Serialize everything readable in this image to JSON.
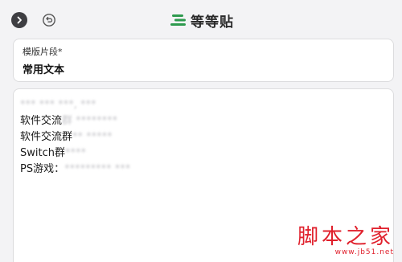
{
  "header": {
    "back_icon": "chevron-right-icon",
    "undo_icon": "undo-icon",
    "brand_name": "等等贴",
    "brand_color": "#2e9a4e"
  },
  "template": {
    "label": "模版片段*",
    "value": "常用文本"
  },
  "content": {
    "lines": [
      {
        "label": "",
        "redacted": "*** *** ***, ***"
      },
      {
        "label": "软件交流",
        "redacted": "群 ********"
      },
      {
        "label": "软件交流群",
        "redacted": "** *****"
      },
      {
        "label": "Switch群",
        "redacted": "****"
      },
      {
        "label": "PS游戏：",
        "redacted": "********* ***"
      }
    ]
  },
  "watermark": {
    "title": "脚本之家",
    "url": "www.jb51.net"
  }
}
